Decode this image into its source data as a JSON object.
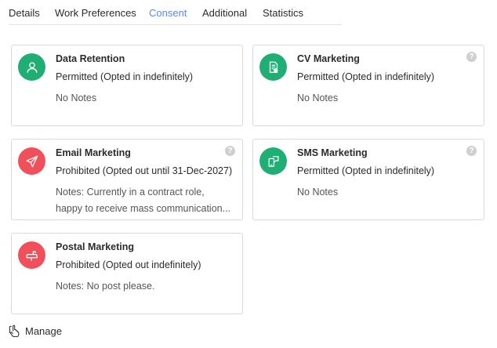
{
  "tabs": [
    {
      "label": "Details",
      "active": false
    },
    {
      "label": "Work Preferences",
      "active": false
    },
    {
      "label": "Consent",
      "active": true
    },
    {
      "label": "Additional",
      "active": false
    },
    {
      "label": "Statistics",
      "active": false
    }
  ],
  "cards": [
    {
      "title": "Data Retention",
      "status": "Permitted (Opted in indefinitely)",
      "notes": "No Notes",
      "state": "permitted",
      "icon": "user-icon",
      "help": false
    },
    {
      "title": "CV Marketing",
      "status": "Permitted (Opted in indefinitely)",
      "notes": "No Notes",
      "state": "permitted",
      "icon": "document-icon",
      "help": true
    },
    {
      "title": "Email Marketing",
      "status": "Prohibited (Opted out until 31-Dec-2027)",
      "notes_lines": [
        "Notes: Currently in a contract role,",
        "happy to receive mass communication..."
      ],
      "state": "prohibited",
      "icon": "paper-plane-icon",
      "help": true
    },
    {
      "title": "SMS Marketing",
      "status": "Permitted (Opted in indefinitely)",
      "notes": "No Notes",
      "state": "permitted",
      "icon": "phone-message-icon",
      "help": true
    },
    {
      "title": "Postal Marketing",
      "status": "Prohibited (Opted out indefinitely)",
      "notes": "Notes: No post please.",
      "state": "prohibited",
      "icon": "mailbox-icon",
      "help": false
    }
  ],
  "help_glyph": "?",
  "manage": {
    "label": "Manage",
    "icon": "hand-pointer-icon"
  },
  "colors": {
    "permitted": "#1fae74",
    "prohibited": "#f1505a",
    "active_tab": "#5b8ad8"
  }
}
